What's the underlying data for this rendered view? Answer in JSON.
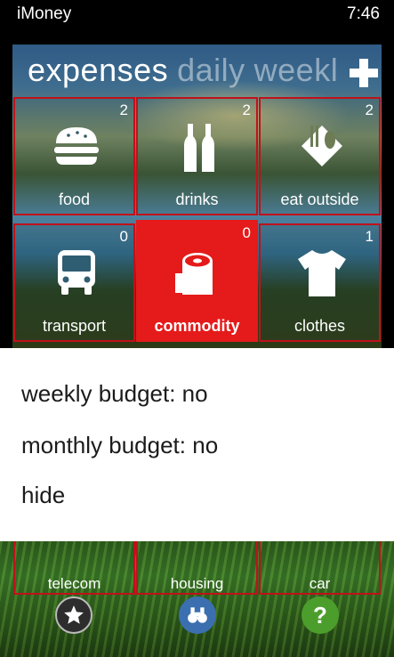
{
  "status_bar": {
    "app_name": "iMoney",
    "time": "7:46"
  },
  "panorama": {
    "active_section": "expenses",
    "sections": [
      "daily",
      "weekl"
    ]
  },
  "tiles": [
    {
      "label": "food",
      "count": "2",
      "icon": "burger-icon"
    },
    {
      "label": "drinks",
      "count": "2",
      "icon": "bottles-icon"
    },
    {
      "label": "eat outside",
      "count": "2",
      "icon": "cutlery-icon"
    },
    {
      "label": "transport",
      "count": "0",
      "icon": "bus-icon"
    },
    {
      "label": "commodity",
      "count": "0",
      "icon": "toilet-paper-icon"
    },
    {
      "label": "clothes",
      "count": "1",
      "icon": "shirt-icon"
    }
  ],
  "context_menu": {
    "items": [
      "weekly budget: no",
      "monthly budget: no",
      "hide"
    ]
  },
  "bottom_tiles": [
    {
      "label": "telecom"
    },
    {
      "label": "housing"
    },
    {
      "label": "car"
    }
  ],
  "app_bar": {
    "buttons": [
      {
        "icon": "star-icon",
        "color": "#2d2d2d"
      },
      {
        "icon": "binoculars-icon",
        "color": "#3b6fb0"
      },
      {
        "icon": "help-icon",
        "color": "#4c9e2c"
      }
    ]
  },
  "colors": {
    "accent": "#e51a1a",
    "tile_border": "#c0111a"
  }
}
